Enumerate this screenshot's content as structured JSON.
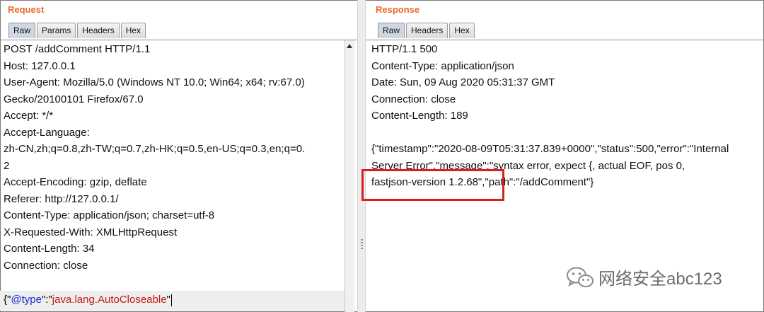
{
  "request": {
    "title": "Request",
    "tabs": [
      "Raw",
      "Params",
      "Headers",
      "Hex"
    ],
    "lines": [
      "POST /addComment HTTP/1.1",
      "Host: 127.0.0.1",
      "User-Agent: Mozilla/5.0 (Windows NT 10.0; Win64; x64; rv:67.0)",
      "Gecko/20100101 Firefox/67.0",
      "Accept: */*",
      "Accept-Language:",
      "zh-CN,zh;q=0.8,zh-TW;q=0.7,zh-HK;q=0.5,en-US;q=0.3,en;q=0.",
      "2",
      "Accept-Encoding: gzip, deflate",
      "Referer: http://127.0.0.1/",
      "Content-Type: application/json; charset=utf-8",
      "X-Requested-With: XMLHttpRequest",
      "Content-Length: 34",
      "Connection: close"
    ],
    "body": {
      "open": "{\"",
      "key": "@type",
      "mid": "\":\"",
      "value": "java.lang.AutoCloseable",
      "close": "\""
    }
  },
  "response": {
    "title": "Response",
    "tabs": [
      "Raw",
      "Headers",
      "Hex"
    ],
    "lines": [
      "HTTP/1.1 500",
      "Content-Type: application/json",
      "Date: Sun, 09 Aug 2020 05:31:37 GMT",
      "Connection: close",
      "Content-Length: 189",
      "",
      "{\"timestamp\":\"2020-08-09T05:31:37.839+0000\",\"status\":500,\"error\":\"Internal",
      "Server Error\",\"message\":\"syntax error, expect {, actual EOF, pos 0,",
      "fastjson-version 1.2.68\",\"path\":\"/addComment\"}"
    ]
  },
  "watermark": {
    "text": "网络安全abc123",
    "icon": "wechat-icon"
  },
  "colors": {
    "title": "#e96a2a",
    "highlight": "#d92020",
    "json_key": "#1e2bd0",
    "json_string": "#c41a16"
  }
}
